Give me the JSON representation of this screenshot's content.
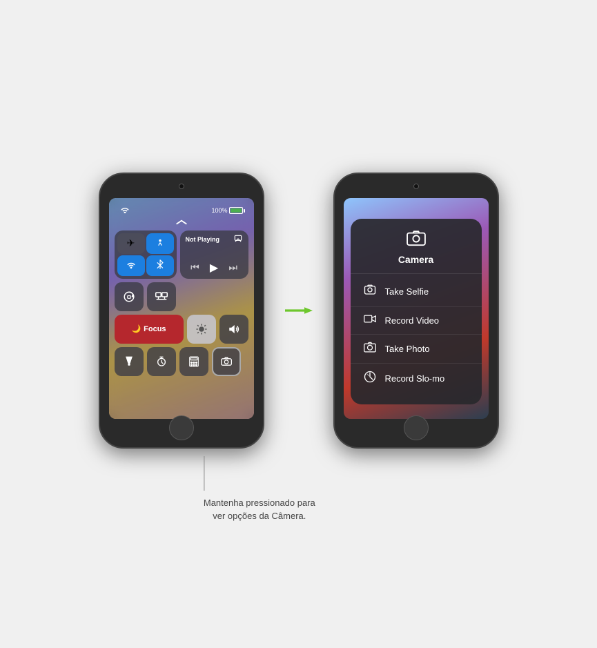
{
  "arrow": "→",
  "left_phone": {
    "status": {
      "wifi": "WiFi",
      "battery_percent": "100%"
    },
    "dismiss_chevron": "⌃",
    "connectivity": {
      "airplane": "✈",
      "airdrop": "📡",
      "wifi": "WiFi",
      "bluetooth": "Bluetooth"
    },
    "now_playing": {
      "title": "Not Playing",
      "airplay_icon": "📺"
    },
    "row2": [
      "orientation-lock",
      "screen-mirror"
    ],
    "focus": {
      "icon": "🌙",
      "label": "Focus"
    },
    "brightness_icon": "☀",
    "volume_icon": "🔊",
    "bottom_tiles": [
      "flashlight",
      "timer",
      "calculator",
      "camera"
    ]
  },
  "right_phone": {
    "camera_menu": {
      "title": "Camera",
      "items": [
        {
          "icon": "selfie",
          "label": "Take Selfie"
        },
        {
          "icon": "video",
          "label": "Record Video"
        },
        {
          "icon": "photo",
          "label": "Take Photo"
        },
        {
          "icon": "slomo",
          "label": "Record Slo-mo"
        }
      ]
    }
  },
  "callout_text": "Mantenha pressionado para\nver opções da Câmera."
}
